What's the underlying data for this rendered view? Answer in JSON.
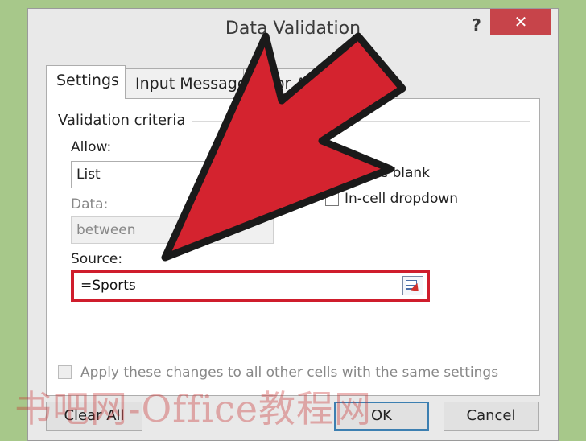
{
  "dialog": {
    "title": "Data Validation",
    "help_label": "?",
    "close_label": "✕",
    "tabs": [
      {
        "label": "Settings"
      },
      {
        "label": "Input Message"
      },
      {
        "label": "Error Alert"
      }
    ]
  },
  "settings": {
    "group_title": "Validation criteria",
    "allow_label": "Allow:",
    "allow_value": "List",
    "data_label": "Data:",
    "data_value": "between",
    "ignore_blank_label": "Ignore blank",
    "in_cell_dropdown_label": "In-cell dropdown",
    "source_label": "Source:",
    "source_value": "=Sports",
    "apply_label": "Apply these changes to all other cells with the same settings"
  },
  "buttons": {
    "clear_all": "Clear All",
    "ok": "OK",
    "cancel": "Cancel"
  },
  "watermark": "书吧网-Office教程网",
  "colors": {
    "arrow": "#d4232f",
    "highlight": "#cf1d2c",
    "background": "#a7c88a"
  }
}
